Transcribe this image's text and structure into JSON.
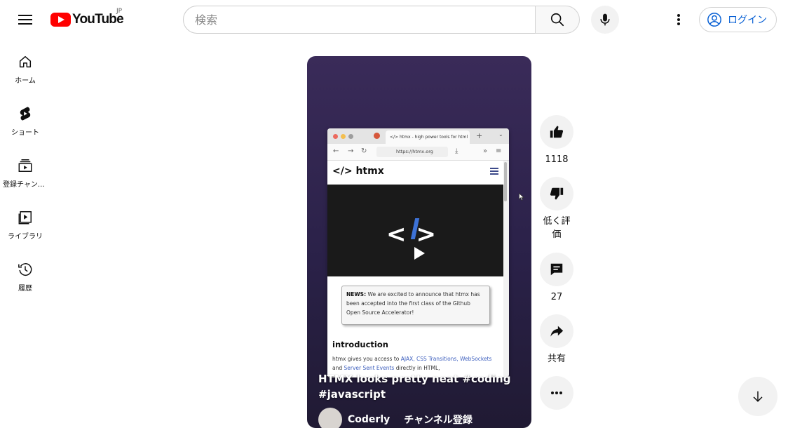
{
  "header": {
    "logo_text": "YouTube",
    "region": "JP",
    "search_placeholder": "検索",
    "login_label": "ログイン"
  },
  "sidebar": {
    "items": [
      {
        "label": "ホーム",
        "icon": "home-icon"
      },
      {
        "label": "ショート",
        "icon": "shorts-icon"
      },
      {
        "label": "登録チャンネル",
        "icon": "subscriptions-icon"
      },
      {
        "label": "ライブラリ",
        "icon": "library-icon"
      },
      {
        "label": "履歴",
        "icon": "history-icon"
      }
    ]
  },
  "short": {
    "title": "HTMX looks pretty neat #coding #javascript",
    "channel_name": "Coderly",
    "subscribe_label": "チャンネル登録",
    "browser": {
      "tab_title": "</> htmx - high power tools for html",
      "url": "https://htmx.org",
      "logo": "</> htmx",
      "news_label": "NEWS:",
      "news_text": " We are excited to announce that htmx has been accepted into the first class of the Github Open Source Accelerator!",
      "intro_heading": "introduction",
      "intro_before": "htmx gives you access to ",
      "intro_links": "AJAX, CSS Transitions, WebSockets",
      "intro_middle": " and ",
      "intro_link2": "Server Sent Events",
      "intro_after": " directly in HTML,"
    }
  },
  "actions": {
    "like_count": "1118",
    "dislike_label": "低く評価",
    "comment_count": "27",
    "share_label": "共有"
  },
  "colors": {
    "brand": "#ff0000",
    "link": "#065fd4"
  }
}
